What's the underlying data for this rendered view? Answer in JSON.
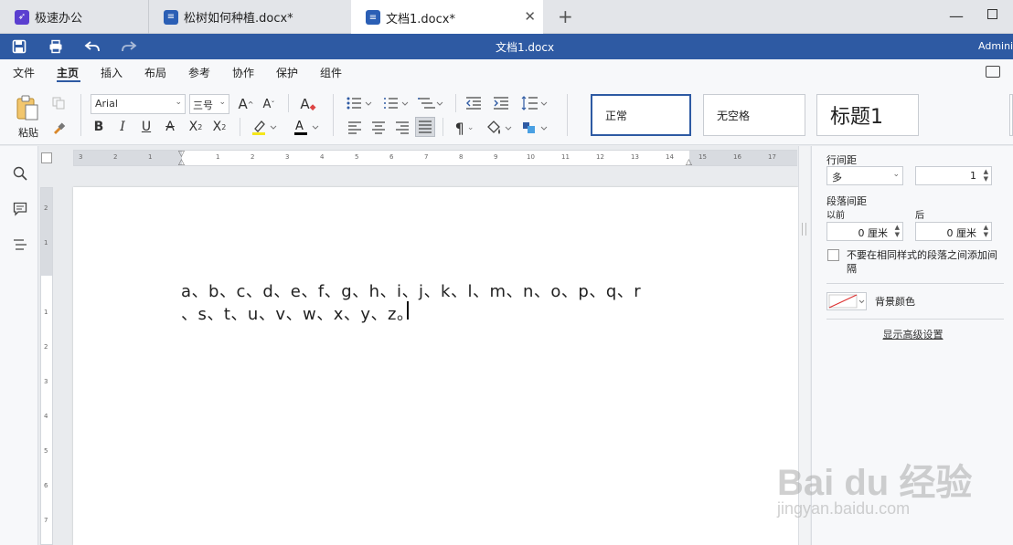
{
  "tabs": [
    {
      "label": "极速办公",
      "icon": "rocket-icon"
    },
    {
      "label": "松树如何种植.docx*",
      "icon": "doc-icon"
    },
    {
      "label": "文档1.docx*",
      "icon": "doc-icon",
      "active": true
    }
  ],
  "window": {
    "close_glyph": "✕",
    "add_glyph": "+",
    "min_glyph": "—"
  },
  "titlebar": {
    "title": "文档1.docx",
    "user": "Adminis"
  },
  "menu": [
    "文件",
    "主页",
    "插入",
    "布局",
    "参考",
    "协作",
    "保护",
    "组件"
  ],
  "ribbon": {
    "paste_label": "粘贴",
    "font_name": "Arial",
    "font_size": "三号",
    "styles": [
      "正常",
      "无空格",
      "标题1"
    ]
  },
  "ruler": {
    "h_ticks": [
      "3",
      "2",
      "1",
      "1",
      "2",
      "3",
      "4",
      "5",
      "6",
      "7",
      "8",
      "9",
      "10",
      "11",
      "12",
      "13",
      "14",
      "15",
      "16",
      "17"
    ],
    "v_ticks": [
      "2",
      "1",
      "1",
      "2",
      "3",
      "4",
      "5",
      "6",
      "7"
    ]
  },
  "document": {
    "line1": "a、b、c、d、e、f、g、h、i、j、k、l、m、n、o、p、q、r",
    "line2": "、s、t、u、v、w、x、y、z。"
  },
  "panel": {
    "line_spacing_label": "行间距",
    "line_spacing_type": "多",
    "line_spacing_value": "1",
    "para_spacing_label": "段落间距",
    "before_label": "以前",
    "after_label": "后",
    "before_value": "0 厘米",
    "after_value": "0 厘米",
    "no_space_label": "不要在相同样式的段落之间添加间隔",
    "bg_color_label": "背景颜色",
    "advanced_label": "显示高级设置"
  },
  "watermark": {
    "line1": "Bai du 经验",
    "line2": "jingyan.baidu.com"
  },
  "colors": {
    "accent": "#2e5aa3",
    "highlight": "#f5e61a",
    "font_color": "#000000"
  }
}
